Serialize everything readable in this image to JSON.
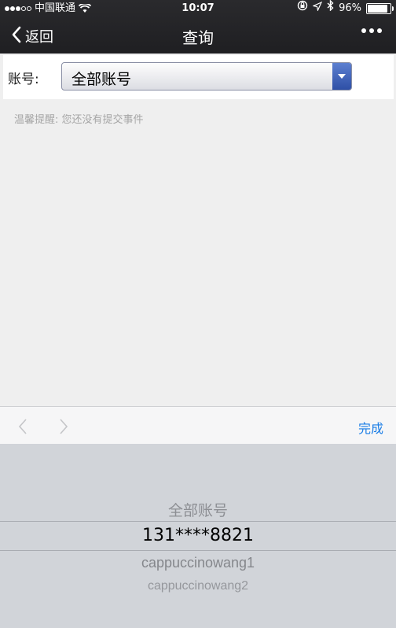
{
  "status_bar": {
    "carrier": "中国联通",
    "time": "10:07",
    "battery_percent": "96%",
    "battery_level": 0.96,
    "icons": [
      "signal-dots",
      "wifi-icon",
      "orientation-lock-icon",
      "location-icon",
      "bluetooth-icon",
      "battery-icon"
    ]
  },
  "nav": {
    "back_label": "返回",
    "title": "查询",
    "icons": [
      "chevron-left-icon",
      "more-icon"
    ]
  },
  "form": {
    "account_label": "账号:",
    "account_selected": "全部账号"
  },
  "tip": "温馨提醒: 您还没有提交事件",
  "toolbar": {
    "done_label": "完成",
    "icons": [
      "chevron-left-icon",
      "chevron-right-icon"
    ]
  },
  "picker": {
    "options": [
      "全部账号",
      "131****8821",
      "cappuccinowang1",
      "cappuccinowang2"
    ],
    "selected_index": 1
  },
  "colors": {
    "nav_bg": "#222225",
    "accent_blue": "#1a7de6",
    "select_arrow": "#3656ad",
    "page_bg": "#efefef",
    "picker_bg": "#d1d4d9"
  }
}
